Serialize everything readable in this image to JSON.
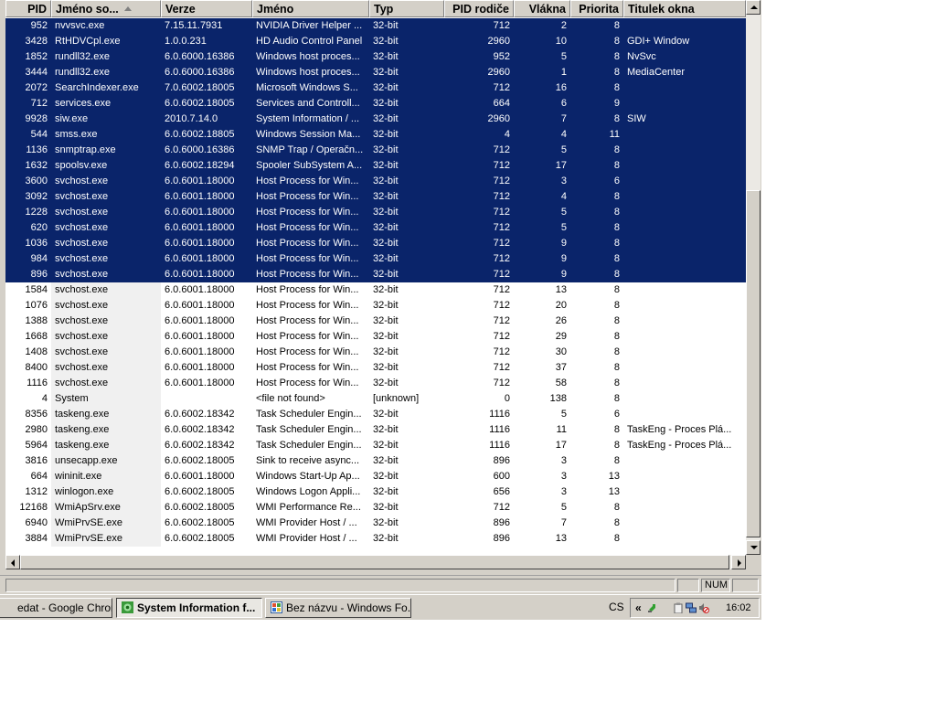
{
  "columns": [
    {
      "label": "PID",
      "align": "right",
      "sorted": false
    },
    {
      "label": "Jméno so...",
      "align": "left",
      "sorted": true
    },
    {
      "label": "Verze",
      "align": "left",
      "sorted": false
    },
    {
      "label": "Jméno",
      "align": "left",
      "sorted": false
    },
    {
      "label": "Typ",
      "align": "left",
      "sorted": false
    },
    {
      "label": "PID rodiče",
      "align": "right",
      "sorted": false
    },
    {
      "label": "Vlákna",
      "align": "right",
      "sorted": false
    },
    {
      "label": "Priorita",
      "align": "right",
      "sorted": false
    },
    {
      "label": "Titulek okna",
      "align": "left",
      "sorted": false
    }
  ],
  "rows": [
    {
      "selected": true,
      "cells": [
        "952",
        "nvvsvc.exe",
        "7.15.11.7931",
        "NVIDIA Driver Helper ...",
        "32-bit",
        "712",
        "2",
        "8",
        ""
      ]
    },
    {
      "selected": true,
      "cells": [
        "3428",
        "RtHDVCpl.exe",
        "1.0.0.231",
        "HD Audio Control Panel",
        "32-bit",
        "2960",
        "10",
        "8",
        "GDI+ Window"
      ]
    },
    {
      "selected": true,
      "cells": [
        "1852",
        "rundll32.exe",
        "6.0.6000.16386",
        "Windows host proces...",
        "32-bit",
        "952",
        "5",
        "8",
        "NvSvc"
      ]
    },
    {
      "selected": true,
      "cells": [
        "3444",
        "rundll32.exe",
        "6.0.6000.16386",
        "Windows host proces...",
        "32-bit",
        "2960",
        "1",
        "8",
        "MediaCenter"
      ]
    },
    {
      "selected": true,
      "cells": [
        "2072",
        "SearchIndexer.exe",
        "7.0.6002.18005",
        "Microsoft Windows S...",
        "32-bit",
        "712",
        "16",
        "8",
        ""
      ]
    },
    {
      "selected": true,
      "cells": [
        "712",
        "services.exe",
        "6.0.6002.18005",
        "Services and Controll...",
        "32-bit",
        "664",
        "6",
        "9",
        ""
      ]
    },
    {
      "selected": true,
      "cells": [
        "9928",
        "siw.exe",
        "2010.7.14.0",
        "System Information / ...",
        "32-bit",
        "2960",
        "7",
        "8",
        "SIW"
      ]
    },
    {
      "selected": true,
      "cells": [
        "544",
        "smss.exe",
        "6.0.6002.18805",
        "Windows Session Ma...",
        "32-bit",
        "4",
        "4",
        "11",
        ""
      ]
    },
    {
      "selected": true,
      "cells": [
        "1136",
        "snmptrap.exe",
        "6.0.6000.16386",
        "SNMP Trap / Operačn...",
        "32-bit",
        "712",
        "5",
        "8",
        ""
      ]
    },
    {
      "selected": true,
      "cells": [
        "1632",
        "spoolsv.exe",
        "6.0.6002.18294",
        "Spooler SubSystem A...",
        "32-bit",
        "712",
        "17",
        "8",
        ""
      ]
    },
    {
      "selected": true,
      "cells": [
        "3600",
        "svchost.exe",
        "6.0.6001.18000",
        "Host Process for Win...",
        "32-bit",
        "712",
        "3",
        "6",
        ""
      ]
    },
    {
      "selected": true,
      "cells": [
        "3092",
        "svchost.exe",
        "6.0.6001.18000",
        "Host Process for Win...",
        "32-bit",
        "712",
        "4",
        "8",
        ""
      ]
    },
    {
      "selected": true,
      "cells": [
        "1228",
        "svchost.exe",
        "6.0.6001.18000",
        "Host Process for Win...",
        "32-bit",
        "712",
        "5",
        "8",
        ""
      ]
    },
    {
      "selected": true,
      "cells": [
        "620",
        "svchost.exe",
        "6.0.6001.18000",
        "Host Process for Win...",
        "32-bit",
        "712",
        "5",
        "8",
        ""
      ]
    },
    {
      "selected": true,
      "cells": [
        "1036",
        "svchost.exe",
        "6.0.6001.18000",
        "Host Process for Win...",
        "32-bit",
        "712",
        "9",
        "8",
        ""
      ]
    },
    {
      "selected": true,
      "cells": [
        "984",
        "svchost.exe",
        "6.0.6001.18000",
        "Host Process for Win...",
        "32-bit",
        "712",
        "9",
        "8",
        ""
      ]
    },
    {
      "selected": true,
      "cells": [
        "896",
        "svchost.exe",
        "6.0.6001.18000",
        "Host Process for Win...",
        "32-bit",
        "712",
        "9",
        "8",
        ""
      ]
    },
    {
      "selected": false,
      "cells": [
        "1584",
        "svchost.exe",
        "6.0.6001.18000",
        "Host Process for Win...",
        "32-bit",
        "712",
        "13",
        "8",
        ""
      ]
    },
    {
      "selected": false,
      "cells": [
        "1076",
        "svchost.exe",
        "6.0.6001.18000",
        "Host Process for Win...",
        "32-bit",
        "712",
        "20",
        "8",
        ""
      ]
    },
    {
      "selected": false,
      "cells": [
        "1388",
        "svchost.exe",
        "6.0.6001.18000",
        "Host Process for Win...",
        "32-bit",
        "712",
        "26",
        "8",
        ""
      ]
    },
    {
      "selected": false,
      "cells": [
        "1668",
        "svchost.exe",
        "6.0.6001.18000",
        "Host Process for Win...",
        "32-bit",
        "712",
        "29",
        "8",
        ""
      ]
    },
    {
      "selected": false,
      "cells": [
        "1408",
        "svchost.exe",
        "6.0.6001.18000",
        "Host Process for Win...",
        "32-bit",
        "712",
        "30",
        "8",
        ""
      ]
    },
    {
      "selected": false,
      "cells": [
        "8400",
        "svchost.exe",
        "6.0.6001.18000",
        "Host Process for Win...",
        "32-bit",
        "712",
        "37",
        "8",
        ""
      ]
    },
    {
      "selected": false,
      "cells": [
        "1116",
        "svchost.exe",
        "6.0.6001.18000",
        "Host Process for Win...",
        "32-bit",
        "712",
        "58",
        "8",
        ""
      ]
    },
    {
      "selected": false,
      "cells": [
        "4",
        "System",
        "",
        "<file not found>",
        "[unknown]",
        "0",
        "138",
        "8",
        ""
      ]
    },
    {
      "selected": false,
      "cells": [
        "8356",
        "taskeng.exe",
        "6.0.6002.18342",
        "Task Scheduler Engin...",
        "32-bit",
        "1116",
        "5",
        "6",
        ""
      ]
    },
    {
      "selected": false,
      "cells": [
        "2980",
        "taskeng.exe",
        "6.0.6002.18342",
        "Task Scheduler Engin...",
        "32-bit",
        "1116",
        "11",
        "8",
        "TaskEng - Proces Plá..."
      ]
    },
    {
      "selected": false,
      "cells": [
        "5964",
        "taskeng.exe",
        "6.0.6002.18342",
        "Task Scheduler Engin...",
        "32-bit",
        "1116",
        "17",
        "8",
        "TaskEng - Proces Plá..."
      ]
    },
    {
      "selected": false,
      "cells": [
        "3816",
        "unsecapp.exe",
        "6.0.6002.18005",
        "Sink to receive async...",
        "32-bit",
        "896",
        "3",
        "8",
        ""
      ]
    },
    {
      "selected": false,
      "cells": [
        "664",
        "wininit.exe",
        "6.0.6001.18000",
        "Windows Start-Up Ap...",
        "32-bit",
        "600",
        "3",
        "13",
        ""
      ]
    },
    {
      "selected": false,
      "cells": [
        "1312",
        "winlogon.exe",
        "6.0.6002.18005",
        "Windows Logon Appli...",
        "32-bit",
        "656",
        "3",
        "13",
        ""
      ]
    },
    {
      "selected": false,
      "cells": [
        "12168",
        "WmiApSrv.exe",
        "6.0.6002.18005",
        "WMI Performance Re...",
        "32-bit",
        "712",
        "5",
        "8",
        ""
      ]
    },
    {
      "selected": false,
      "cells": [
        "6940",
        "WmiPrvSE.exe",
        "6.0.6002.18005",
        "WMI Provider Host / ...",
        "32-bit",
        "896",
        "7",
        "8",
        ""
      ]
    },
    {
      "selected": false,
      "cells": [
        "3884",
        "WmiPrvSE.exe",
        "6.0.6002.18005",
        "WMI Provider Host / ...",
        "32-bit",
        "896",
        "13",
        "8",
        ""
      ]
    }
  ],
  "statusbar": {
    "num": "NUM"
  },
  "taskbar": {
    "buttons": [
      {
        "label": "edat - Google Chrome",
        "icon": "chrome-icon",
        "active": false
      },
      {
        "label": "System Information f...",
        "icon": "siw-app-icon",
        "active": true
      },
      {
        "label": "Bez názvu - Windows Fo...",
        "icon": "photo-viewer-icon",
        "active": false
      }
    ],
    "language": "CS",
    "expand": "«",
    "clock": "16:02"
  },
  "colors": {
    "selection": "#0a246a",
    "selection_text": "#ffffff",
    "face": "#d4d0c8"
  }
}
